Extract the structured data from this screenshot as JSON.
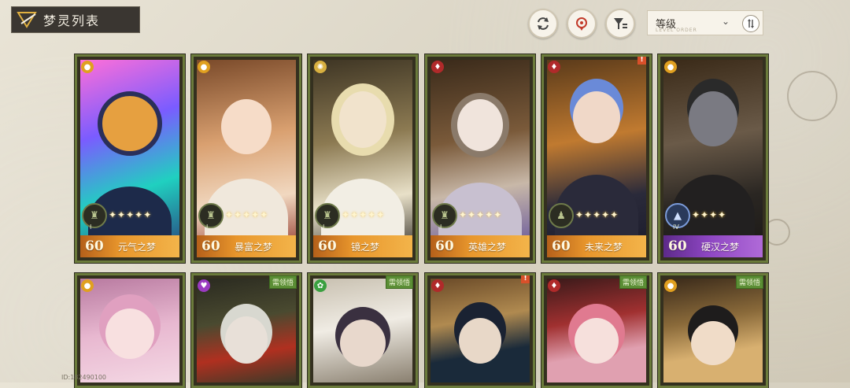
{
  "header": {
    "title": "梦灵列表",
    "sort": {
      "label": "等级",
      "sub_label": "LEVEL ORDER"
    },
    "buttons": [
      "refresh-icon",
      "locate-icon",
      "filter-icon"
    ]
  },
  "colors": {
    "frame": "#6b7b3b",
    "bar_orange": "#e8962c",
    "bar_purple": "#8d46c2",
    "need_tag": "#5b8e35"
  },
  "cards_top": [
    {
      "level": "60",
      "name": "元气之梦",
      "element": "fire",
      "role_tier": "I",
      "stars": "✦✦✦✦✦",
      "rarity": "orange"
    },
    {
      "level": "60",
      "name": "暴富之梦",
      "element": "fire",
      "role_tier": "I",
      "stars": "✦✦✦✦✦",
      "rarity": "orange"
    },
    {
      "level": "60",
      "name": "镜之梦",
      "element": "light",
      "role_tier": "I",
      "stars": "✦✦✦✦✦",
      "rarity": "orange"
    },
    {
      "level": "60",
      "name": "英雄之梦",
      "element": "blood",
      "role_tier": "I",
      "stars": "✦✦✦✦✦",
      "rarity": "orange"
    },
    {
      "level": "60",
      "name": "未来之梦",
      "element": "blood",
      "role_tier": "",
      "stars": "✦✦✦✦✦",
      "rarity": "orange",
      "alert": "!"
    },
    {
      "level": "60",
      "name": "硬汉之梦",
      "element": "fire",
      "role_tier": "IV",
      "stars": "✦✦✦✦",
      "rarity": "purple"
    }
  ],
  "cards_bottom": [
    {
      "element": "fire",
      "tag": ""
    },
    {
      "element": "heart",
      "tag": "需领悟"
    },
    {
      "element": "leaf",
      "tag": "需领悟"
    },
    {
      "element": "blood",
      "tag": "",
      "alert": "!"
    },
    {
      "element": "blood",
      "tag": "需领悟"
    },
    {
      "element": "fire",
      "tag": "需领悟"
    }
  ],
  "footer": {
    "player_id": "ID:182490100"
  }
}
